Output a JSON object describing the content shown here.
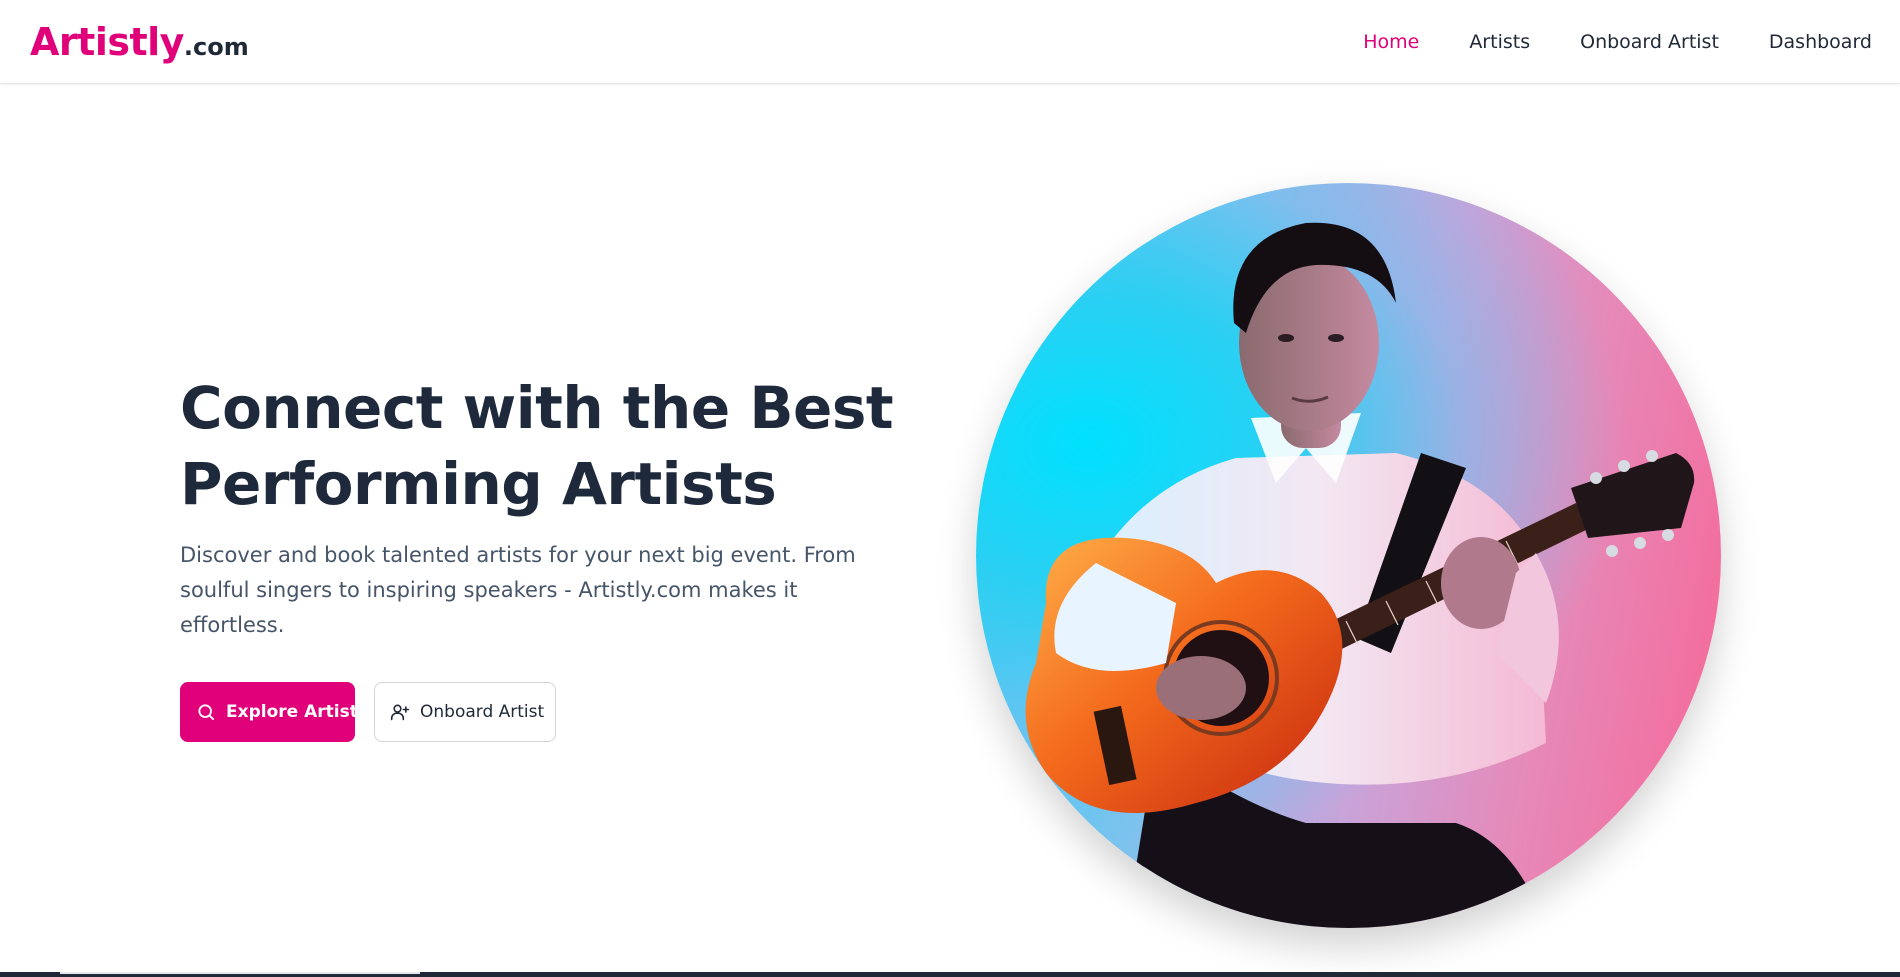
{
  "brand": {
    "name": "Artistly",
    "suffix": ".com",
    "accent_color": "#e0007a",
    "text_color": "#1f2937"
  },
  "nav": {
    "items": [
      {
        "label": "Home",
        "active": true
      },
      {
        "label": "Artists",
        "active": false
      },
      {
        "label": "Onboard Artist",
        "active": false
      },
      {
        "label": "Dashboard",
        "active": false
      }
    ]
  },
  "hero": {
    "title_lines": [
      "Connect with the Best",
      "Performing Artists"
    ],
    "description_lines": [
      "Discover and book talented artists for your next big event. From",
      "soulful singers to inspiring speakers - Artistly.com makes it",
      "effortless."
    ],
    "primary_button": {
      "label": "Explore Artists",
      "icon": "search-icon"
    },
    "secondary_button": {
      "label": "Onboard Artist",
      "icon": "user-plus-icon"
    },
    "image": {
      "subject": "guitarist",
      "icon": "guitarist-photo",
      "background_colors": [
        "#00e1ff",
        "#f76596"
      ]
    }
  }
}
